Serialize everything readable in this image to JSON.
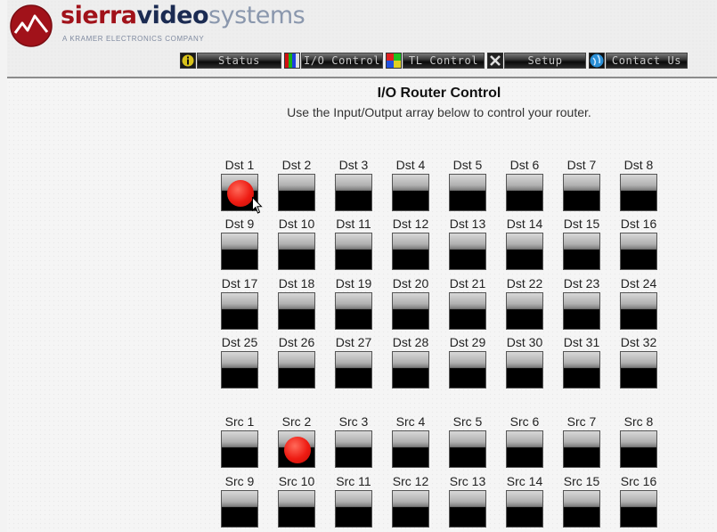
{
  "header": {
    "brand": {
      "part1": "sierra",
      "part2": "video",
      "part3": "systems"
    },
    "tagline": "A KRAMER ELECTRONICS COMPANY",
    "nav": [
      {
        "label": "Status",
        "icon": "info-icon"
      },
      {
        "label": "I/O Control",
        "icon": "rgb-bars-icon"
      },
      {
        "label": "TL Control",
        "icon": "color-blocks-icon"
      },
      {
        "label": "Setup",
        "icon": "tools-icon"
      },
      {
        "label": "Contact Us",
        "icon": "globe-icon"
      }
    ]
  },
  "main": {
    "title": "I/O Router Control",
    "subtitle": "Use the Input/Output array below to control your router.",
    "destinations": [
      "Dst 1",
      "Dst 2",
      "Dst 3",
      "Dst 4",
      "Dst 5",
      "Dst 6",
      "Dst 7",
      "Dst 8",
      "Dst 9",
      "Dst 10",
      "Dst 11",
      "Dst 12",
      "Dst 13",
      "Dst 14",
      "Dst 15",
      "Dst 16",
      "Dst 17",
      "Dst 18",
      "Dst 19",
      "Dst 20",
      "Dst 21",
      "Dst 22",
      "Dst 23",
      "Dst 24",
      "Dst 25",
      "Dst 26",
      "Dst 27",
      "Dst 28",
      "Dst 29",
      "Dst 30",
      "Dst 31",
      "Dst 32"
    ],
    "sources": [
      "Src 1",
      "Src 2",
      "Src 3",
      "Src 4",
      "Src 5",
      "Src 6",
      "Src 7",
      "Src 8",
      "Src 9",
      "Src 10",
      "Src 11",
      "Src 12",
      "Src 13",
      "Src 14",
      "Src 15",
      "Src 16"
    ],
    "selected_destination": "Dst 1",
    "selected_source": "Src 2"
  },
  "colors": {
    "brand_red": "#a1121a",
    "brand_navy": "#1b2b52",
    "brand_gray": "#8a97ad",
    "selection_dot": "#ee1b12"
  }
}
